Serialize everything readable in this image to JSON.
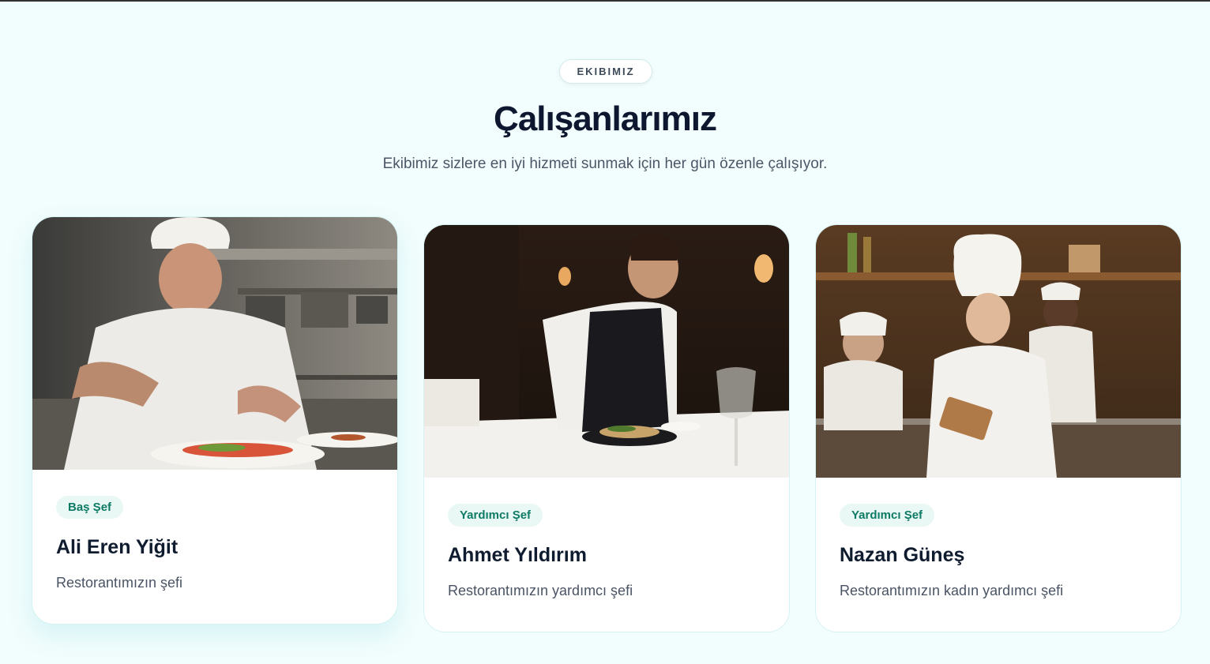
{
  "section": {
    "eyebrow": "EKIBIMIZ",
    "title": "Çalışanlarımız",
    "subtitle": "Ekibimiz sizlere en iyi hizmeti sunmak için her gün özenle çalışıyor."
  },
  "team": [
    {
      "role": "Baş Şef",
      "name": "Ali Eren Yiğit",
      "description": "Restorantımızın şefi"
    },
    {
      "role": "Yardımcı Şef",
      "name": "Ahmet Yıldırım",
      "description": "Restorantımızın yardımcı şefi"
    },
    {
      "role": "Yardımcı Şef",
      "name": "Nazan Güneş",
      "description": "Restorantımızın kadın yardımcı şefi"
    }
  ],
  "colors": {
    "page_background": "#f2fdfd",
    "title": "#0d1830",
    "badge_background": "#e9f8f5",
    "badge_text": "#0c7a64"
  }
}
